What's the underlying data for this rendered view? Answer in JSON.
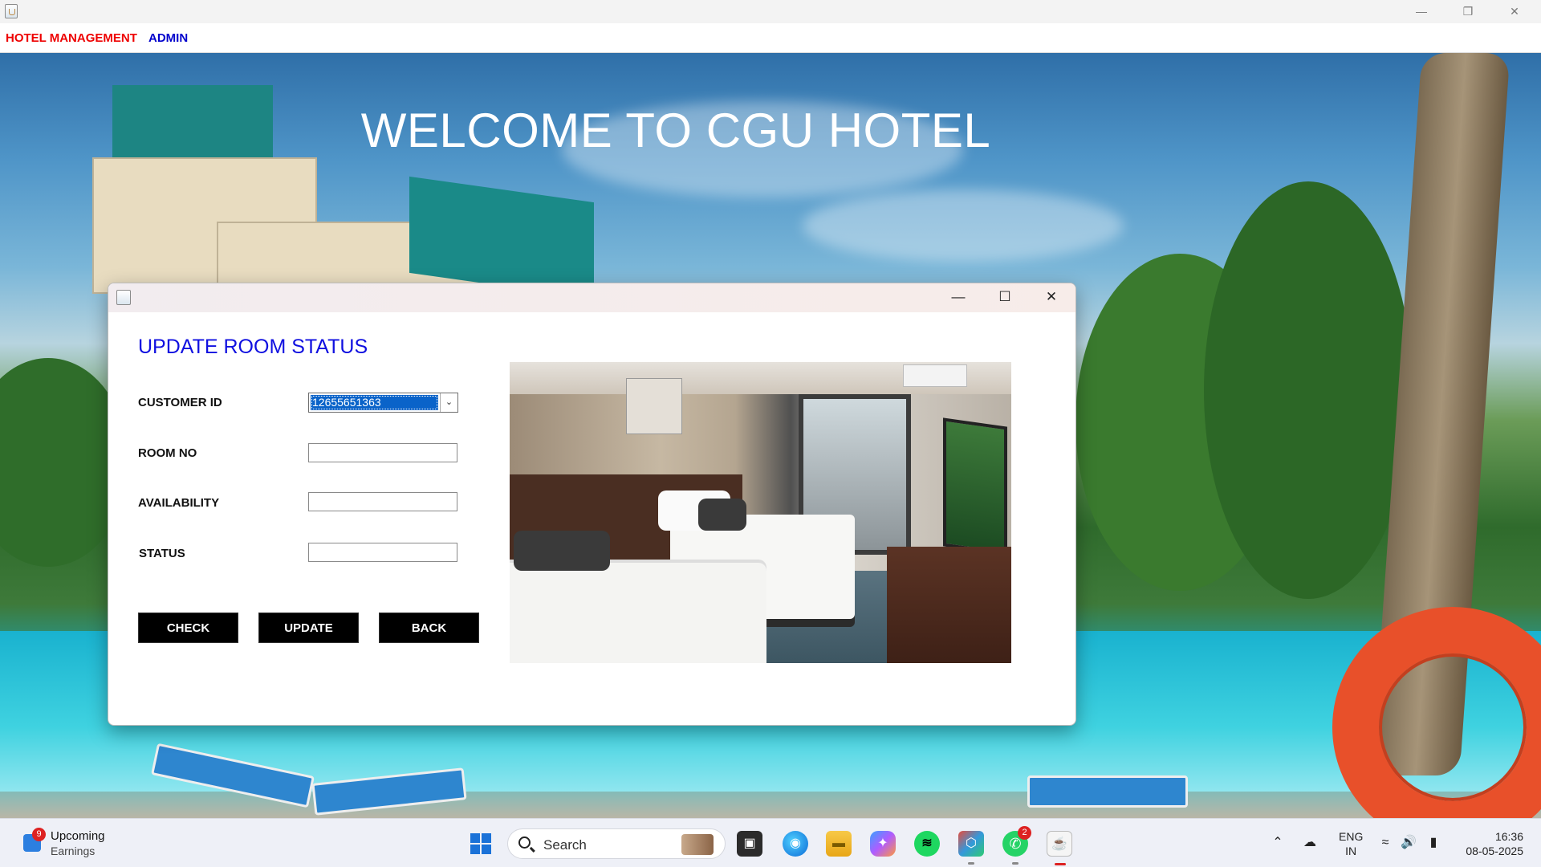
{
  "main_window": {
    "menu": [
      "HOTEL MANAGEMENT",
      "ADMIN"
    ],
    "welcome": "WELCOME TO CGU HOTEL",
    "controls": {
      "minimize": "—",
      "restore": "❐",
      "close": "✕"
    }
  },
  "dialog": {
    "heading": "UPDATE ROOM STATUS",
    "controls": {
      "minimize": "—",
      "maximize": "☐",
      "close": "✕"
    },
    "fields": {
      "customer_id_label": "CUSTOMER ID",
      "customer_id_value": "12655651363",
      "room_no_label": "ROOM NO",
      "room_no_value": "",
      "availability_label": "AVAILABILITY",
      "availability_value": "",
      "status_label": "STATUS",
      "status_value": ""
    },
    "buttons": {
      "check": "CHECK",
      "update": "UPDATE",
      "back": "BACK"
    },
    "colors": {
      "heading": "#1010e0",
      "button_bg": "#000000",
      "selection": "#0a63c9"
    }
  },
  "taskbar": {
    "widget": {
      "badge": "9",
      "title": "Upcoming",
      "subtitle": "Earnings"
    },
    "search_placeholder": "Search",
    "apps": [
      {
        "name": "task-view-icon",
        "glyph": "▣"
      },
      {
        "name": "edge-icon",
        "glyph": "◉"
      },
      {
        "name": "file-explorer-icon",
        "glyph": "▬"
      },
      {
        "name": "copilot-icon",
        "glyph": "✦"
      },
      {
        "name": "spotify-icon",
        "glyph": "≋"
      },
      {
        "name": "office-icon",
        "glyph": "⬡"
      },
      {
        "name": "whatsapp-icon",
        "glyph": "✆",
        "badge": "2"
      },
      {
        "name": "java-icon",
        "glyph": "☕"
      }
    ],
    "tray": {
      "lang_top": "ENG",
      "lang_bottom": "IN",
      "time": "16:36",
      "date": "08-05-2025"
    }
  }
}
